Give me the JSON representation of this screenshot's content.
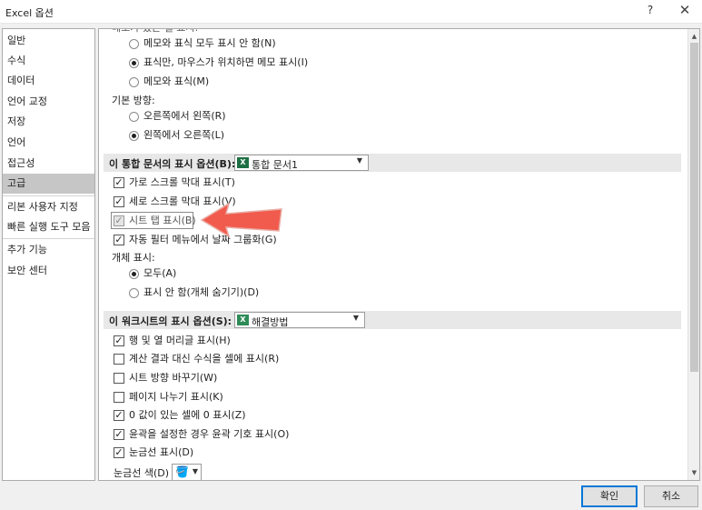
{
  "window": {
    "title": "Excel 옵션",
    "help": "?",
    "close": "✕"
  },
  "sidebar": {
    "items": [
      "일반",
      "수식",
      "데이터",
      "언어 교정",
      "저장",
      "언어",
      "접근성",
      "고급",
      "리본 사용자 지정",
      "빠른 실행 도구 모음",
      "추가 기능",
      "보안 센터"
    ],
    "selected": "고급"
  },
  "main": {
    "top_cut_text": "메모가 있는 셀 표시:",
    "comments": {
      "opt1": "메모와 표식 모두 표시 안 함(N)",
      "opt2": "표식만, 마우스가 위치하면 메모 표시(I)",
      "opt3": "메모와 표식(M)"
    },
    "direction": {
      "label": "기본 방향:",
      "opt1": "오른쪽에서 왼쪽(R)",
      "opt2": "왼쪽에서 오른쪽(L)"
    },
    "workbook_section": {
      "title": "이 통합 문서의 표시 옵션(B):",
      "dropdown_value": "통합 문서1",
      "items": [
        {
          "label": "가로 스크롤 막대 표시(T)",
          "checked": true
        },
        {
          "label": "세로 스크롤 막대 표시(V)",
          "checked": true
        },
        {
          "label": "시트 탭 표시(B)",
          "checked": true,
          "disabled": true
        },
        {
          "label": "자동 필터 메뉴에서 날짜 그룹화(G)",
          "checked": true
        }
      ],
      "objects_label": "개체 표시:",
      "objects_all": "모두(A)",
      "objects_none": "표시 안 함(개체 숨기기)(D)"
    },
    "worksheet_section": {
      "title": "이 워크시트의 표시 옵션(S):",
      "dropdown_value": "해결방법",
      "items": [
        {
          "label": "행 및 열 머리글 표시(H)",
          "checked": true
        },
        {
          "label": "계산 결과 대신 수식을 셀에 표시(R)",
          "checked": false
        },
        {
          "label": "시트 방향 바꾸기(W)",
          "checked": false
        },
        {
          "label": "페이지 나누기 표시(K)",
          "checked": false
        },
        {
          "label": "0 값이 있는 셀에 0 표시(Z)",
          "checked": true
        },
        {
          "label": "윤곽을 설정한 경우 윤곽 기호 표시(O)",
          "checked": true
        },
        {
          "label": "눈금선 표시(D)",
          "checked": true
        }
      ],
      "gridline_color_label": "눈금선 색(D)"
    }
  },
  "buttons": {
    "ok": "확인",
    "cancel": "취소"
  },
  "colors": {
    "arrow": "#f04e3e",
    "selected_nav": "#c6c6c6",
    "section_bg": "#e8e8e8"
  }
}
